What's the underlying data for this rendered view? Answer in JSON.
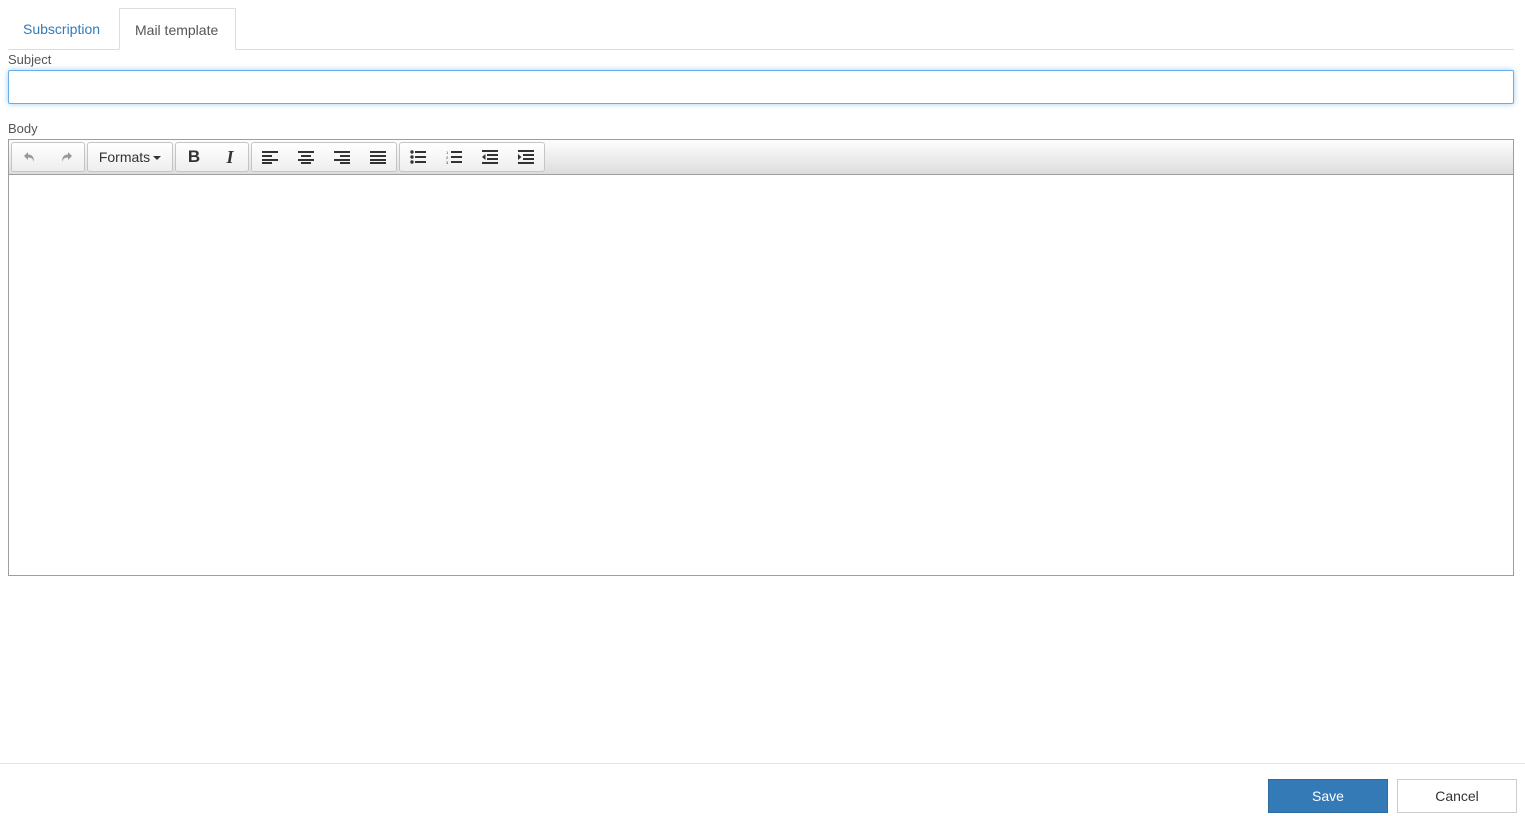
{
  "tabs": [
    {
      "label": "Subscription",
      "active": false
    },
    {
      "label": "Mail template",
      "active": true
    }
  ],
  "subject": {
    "label": "Subject",
    "value": "",
    "placeholder": ""
  },
  "body": {
    "label": "Body",
    "toolbar": {
      "undo": "undo-icon",
      "redo": "redo-icon",
      "formats_label": "Formats",
      "bold": "B",
      "italic": "I",
      "align_left": "align-left-icon",
      "align_center": "align-center-icon",
      "align_right": "align-right-icon",
      "align_justify": "align-justify-icon",
      "bullet_list": "bullet-list-icon",
      "numbered_list": "numbered-list-icon",
      "outdent": "outdent-icon",
      "indent": "indent-icon"
    },
    "content": ""
  },
  "footer": {
    "save_label": "Save",
    "cancel_label": "Cancel",
    "accent": "#337ab7"
  }
}
